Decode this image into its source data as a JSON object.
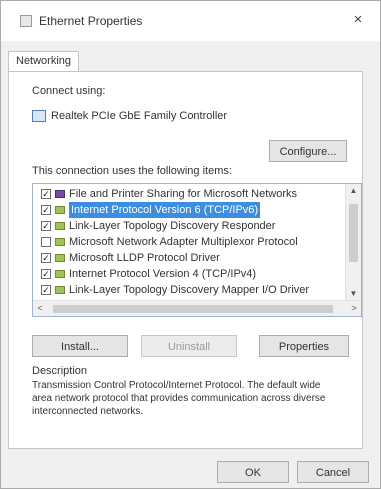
{
  "window": {
    "title": "Ethernet Properties",
    "close_glyph": "×"
  },
  "tabs": [
    {
      "label": "Networking"
    }
  ],
  "connect_using": {
    "label": "Connect using:",
    "adapter": "Realtek PCIe GbE Family Controller",
    "configure_label": "Configure..."
  },
  "items_section": {
    "label": "This connection uses the following items:"
  },
  "items": [
    {
      "label": "File and Printer Sharing for Microsoft Networks",
      "checked": true,
      "icon": "service-icon",
      "selected": false
    },
    {
      "label": "Internet Protocol Version 6 (TCP/IPv6)",
      "checked": true,
      "icon": "protocol-icon",
      "selected": true
    },
    {
      "label": "Link-Layer Topology Discovery Responder",
      "checked": true,
      "icon": "protocol-icon",
      "selected": false
    },
    {
      "label": "Microsoft Network Adapter Multiplexor Protocol",
      "checked": false,
      "icon": "protocol-icon",
      "selected": false
    },
    {
      "label": "Microsoft LLDP Protocol Driver",
      "checked": true,
      "icon": "protocol-icon",
      "selected": false
    },
    {
      "label": "Internet Protocol Version 4 (TCP/IPv4)",
      "checked": true,
      "icon": "protocol-icon",
      "selected": false
    },
    {
      "label": "Link-Layer Topology Discovery Mapper I/O Driver",
      "checked": true,
      "icon": "protocol-icon",
      "selected": false
    }
  ],
  "scrollbar": {
    "up_glyph": "▲",
    "down_glyph": "▼",
    "left_glyph": "<",
    "right_glyph": ">"
  },
  "buttons": {
    "install": "Install...",
    "uninstall": "Uninstall",
    "properties": "Properties"
  },
  "description": {
    "title": "Description",
    "text": "Transmission Control Protocol/Internet Protocol. The default wide area network protocol that provides communication across diverse interconnected networks."
  },
  "footer": {
    "ok": "OK",
    "cancel": "Cancel"
  },
  "colors": {
    "selection": "#3d8ee0",
    "dialog_bg": "#f0f0f0"
  }
}
